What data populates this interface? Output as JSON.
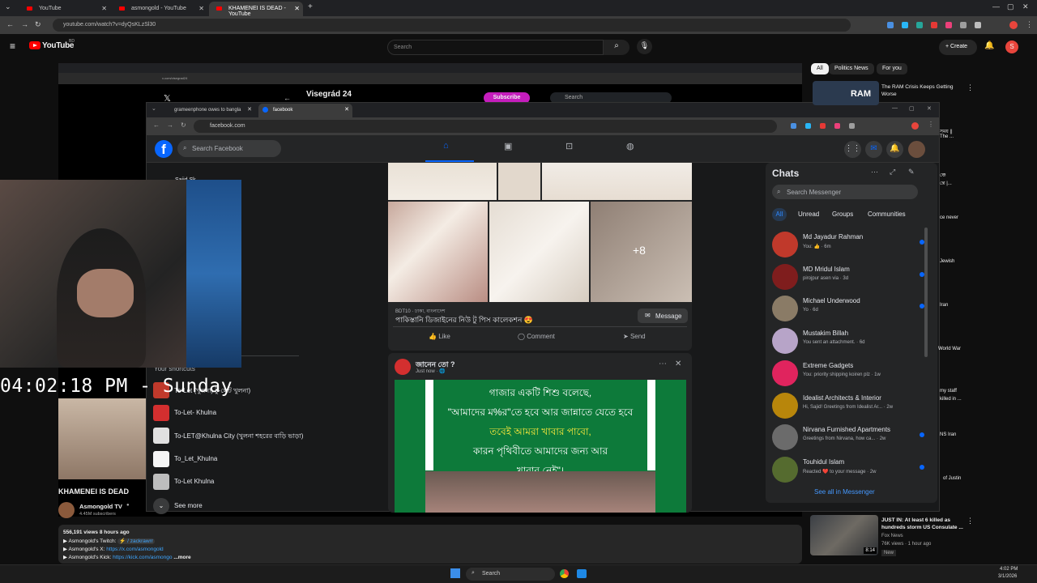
{
  "browser": {
    "tabs": [
      {
        "label": "YouTube"
      },
      {
        "label": "asmongold - YouTube"
      },
      {
        "label": "KHAMENEI IS DEAD - YouTube"
      }
    ],
    "url": "youtube.com/watch?v=dyQsKLzSl30",
    "new_tab": "+"
  },
  "youtube": {
    "logo": "YouTube",
    "logo_sup": "BD",
    "search_placeholder": "Search",
    "create_label": "Create",
    "avatar_letter": "S",
    "video_title": "KHAMENEI IS DEAD",
    "channel_name": "Asmongold TV",
    "subscribers": "4.45M subscribers",
    "views_line": "556,191 views  8 hours ago",
    "desc_lines": [
      "▶ Asmongold's Twitch: ",
      "▶ Asmongold's X: ",
      "▶ Asmongold's Kick: "
    ],
    "desc_links": [
      "⚡ / zackrawrr",
      "https://x.com/asmongold",
      "https://kick.com/asmongo"
    ],
    "more": "...more",
    "chips": [
      "All",
      "Politics News",
      "For you"
    ],
    "side_videos": [
      {
        "title": "The RAM Crisis Keeps Getting Worse",
        "thumb": "RAM"
      },
      {
        "title": "JUST IN: At least 6 killed as hundreds storm US Consulate ...",
        "channel": "Fox News",
        "meta": "76K views · 1 hour ago",
        "badge": "New",
        "duration": "8:14"
      }
    ],
    "side_fragments": [
      "সময় ||",
      "The ...",
      "ঞ্চে",
      "ন্তে |...",
      "ce never",
      "Jewish",
      "Iran",
      "World War",
      "my staff",
      "killed in ...",
      "NS Iran",
      "of Justin"
    ]
  },
  "inner_x": {
    "title": "Visegrád 24",
    "subscribe": "Subscribe",
    "search": "Search",
    "url": "x.com/visegrad24"
  },
  "facebook": {
    "tabs": [
      {
        "label": "grameenphone owes to bangla"
      },
      {
        "label": "facebook"
      }
    ],
    "url": "facebook.com",
    "search_placeholder": "Search Facebook",
    "left_profile": "Sajid Sk",
    "shortcuts_title": "Your shortcuts",
    "shortcuts": [
      "To-Let (খুলনা) টু-লেট খুলনা)",
      "To-Let- Khulna",
      "To-LET@Khulna City (খুলনা শহরের বাড়ি ভাড়া)",
      "To_Let_Khulna",
      "To-Let Khulna"
    ],
    "see_more": "See more",
    "post1": {
      "more_count": "+8",
      "meta": "BDT10 · ঢাকা, বাংলাদেশ",
      "caption": "পাকিস্তানি ডিজাইনের নিউ টু পিস কালেকশন 😍",
      "message": "Message",
      "actions": [
        "Like",
        "Comment",
        "Send"
      ]
    },
    "post2": {
      "page": "জানেন তো ?",
      "time": "Just now · 🌐",
      "lines": [
        "গাজার একটি শিশু বলেছে,",
        "\"আমাদের ম%র\"তে হবে আর জান্নাতে যেতে হবে",
        "তবেই আমরা খাবার পাবো,",
        "কারন পৃথিবীতে আমাদের জন্য আর",
        "খাবার নেই\"।"
      ]
    },
    "chats": {
      "title": "Chats",
      "search_placeholder": "Search Messenger",
      "filters": [
        "All",
        "Unread",
        "Groups",
        "Communities"
      ],
      "items": [
        {
          "name": "Md Jayadur Rahman",
          "preview": "You: 👍 · 6m",
          "color": "#c0392b",
          "dot": true
        },
        {
          "name": "MD Mridul Islam",
          "preview": "pirojpur asen via · 3d",
          "color": "#7f1d1d",
          "dot": true
        },
        {
          "name": "Michael Underwood",
          "preview": "Yo · 6d",
          "color": "#8a7b66",
          "dot": true
        },
        {
          "name": "Mustakim Billah",
          "preview": "You sent an attachment. · 6d",
          "color": "#b7a4c8",
          "dot": false
        },
        {
          "name": "Extreme Gadgets",
          "preview": "You: priority shipping koiren plz · 1w",
          "color": "#e0245e",
          "dot": false
        },
        {
          "name": "Idealist Architects & Interior",
          "preview": "Hi, Sajid! Greetings from Idealist Ar... · 2w",
          "color": "#b8860b",
          "dot": false
        },
        {
          "name": "Nirvana Furnished Apartments",
          "preview": "Greetings from Nirvana, how ca... · 2w",
          "color": "#6b6b6b",
          "dot": true
        },
        {
          "name": "Touhidul Islam",
          "preview": "Reacted ❤️ to your message · 2w",
          "color": "#556b2f",
          "dot": true
        }
      ],
      "see_all": "See all in Messenger"
    }
  },
  "overlay": {
    "clock": "04:02:18 PM - Sunday"
  },
  "taskbar": {
    "search": "Search",
    "time": "4:02 PM",
    "date": "3/1/2026"
  },
  "colors": {
    "fb_blue": "#0866ff",
    "yt_red": "#ff0000",
    "green_post": "#0d7a3a"
  }
}
